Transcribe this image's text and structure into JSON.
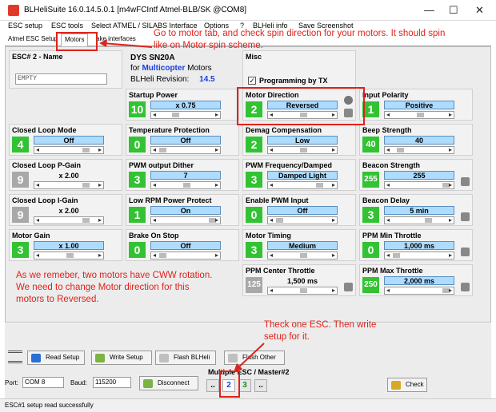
{
  "window": {
    "title": "BLHeliSuite 16.0.14.5.0.1  [m4wFCIntf Atmel-BLB/SK @COM8]",
    "minimize": "—",
    "maximize": "☐",
    "close": "✕"
  },
  "menu": [
    "ESC setup",
    "ESC tools",
    "Select ATMEL / SILABS Interface",
    "Options",
    "?",
    "BLHeli info",
    "Save Screenshot"
  ],
  "tabs": {
    "t1": "Atmel ESC Setup",
    "t2": "Motors",
    "t3": "ake interfaces"
  },
  "esc": {
    "name_label": "ESC# 2 - Name",
    "name_value": "EMPTY",
    "model": "DYS SN20A",
    "for_prefix": "for",
    "multicopter": "Multicopter",
    "motors": "Motors",
    "rev_label": "BLHeli Revision:",
    "rev_value": "14.5",
    "misc_label": "Misc",
    "programming_by_tx": "Programming by TX",
    "check": "✓"
  },
  "settings": {
    "startup_power": {
      "label": "Startup Power",
      "num": "10",
      "value": "x 0.75"
    },
    "motor_direction": {
      "label": "Motor Direction",
      "num": "2",
      "value": "Reversed"
    },
    "input_polarity": {
      "label": "Input Polarity",
      "num": "1",
      "value": "Positive"
    },
    "closed_loop_mode": {
      "label": "Closed Loop Mode",
      "num": "4",
      "value": "Off"
    },
    "temp_protection": {
      "label": "Temperature Protection",
      "num": "0",
      "value": "Off"
    },
    "demag_comp": {
      "label": "Demag Compensation",
      "num": "2",
      "value": "Low"
    },
    "beep_strength": {
      "label": "Beep Strength",
      "num": "40",
      "value": "40"
    },
    "closed_loop_p": {
      "label": "Closed Loop P-Gain",
      "num": "9",
      "value": "x 2.00"
    },
    "pwm_dither": {
      "label": "PWM output Dither",
      "num": "3",
      "value": "7"
    },
    "pwm_freq": {
      "label": "PWM Frequency/Damped",
      "num": "3",
      "value": "Damped Light"
    },
    "beacon_strength": {
      "label": "Beacon Strength",
      "num": "255",
      "value": "255"
    },
    "closed_loop_i": {
      "label": "Closed Loop I-Gain",
      "num": "9",
      "value": "x 2.00"
    },
    "low_rpm": {
      "label": "Low RPM Power Protect",
      "num": "1",
      "value": "On"
    },
    "enable_pwm_input": {
      "label": "Enable PWM Input",
      "num": "0",
      "value": "Off"
    },
    "beacon_delay": {
      "label": "Beacon Delay",
      "num": "3",
      "value": "5 min"
    },
    "motor_gain": {
      "label": "Motor Gain",
      "num": "3",
      "value": "x 1.00"
    },
    "brake_on_stop": {
      "label": "Brake On Stop",
      "num": "0",
      "value": "Off"
    },
    "motor_timing": {
      "label": "Motor Timing",
      "num": "3",
      "value": "Medium"
    },
    "ppm_min": {
      "label": "PPM Min Throttle",
      "num": "0",
      "value": "1,000 ms"
    },
    "ppm_center": {
      "label": "PPM Center Throttle",
      "num": "125",
      "value": "1,500 ms"
    },
    "ppm_max": {
      "label": "PPM Max Throttle",
      "num": "250",
      "value": "2,000 ms"
    }
  },
  "annotations": {
    "top": "Go to motor tab, and check spin direction for your motors. It should spin like on Motor spin scheme.",
    "left": "As we remeber, two motors have CWW rotation. We need to change Motor direction for this motors to Reversed.",
    "bottom": "Theck one ESC. Then write setup for it."
  },
  "bottom": {
    "read_setup": "Read Setup",
    "write_setup": "Write Setup",
    "flash_blheli": "Flash BLHeli",
    "flash_other": "Flash Other",
    "port_label": "Port:",
    "port_value": "COM 8",
    "baud_label": "Baud:",
    "baud_value": "115200",
    "disconnect": "Disconnect",
    "multiple_esc": "Multiple ESC / Master#2",
    "esc_prev": "..",
    "esc_2": "2",
    "esc_3": "3",
    "esc_next": "..",
    "check": "Check"
  },
  "status": "ESC#1 setup read successfully",
  "colors": {
    "accent_red": "#e0221b",
    "value_blue": "#aedcff",
    "num_green": "#33c233",
    "num_gray": "#a8a8a8"
  }
}
